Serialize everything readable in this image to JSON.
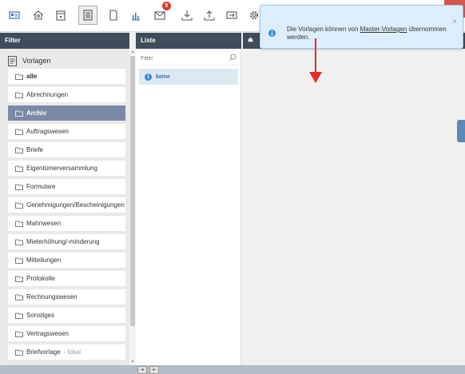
{
  "toolbar": {
    "mail_badge": "9",
    "colors": {
      "accent": "#3a8ad6",
      "badge": "#e0382b"
    }
  },
  "headers": {
    "filter": "Filter",
    "liste": "Liste"
  },
  "filter": {
    "title": "Vorlagen",
    "items": [
      {
        "label": "alle"
      },
      {
        "label": "Abrechnungen"
      },
      {
        "label": "Archiv"
      },
      {
        "label": "Auftragswesen"
      },
      {
        "label": "Briefe"
      },
      {
        "label": "Eigentümerversammlung"
      },
      {
        "label": "Formulare"
      },
      {
        "label": "Genehmigungen/Bescheinigungen"
      },
      {
        "label": "Mahnwesen"
      },
      {
        "label": "Mieterhöhung/-minderung"
      },
      {
        "label": "Mitteilungen"
      },
      {
        "label": "Protokolle"
      },
      {
        "label": "Rechnungswesen"
      },
      {
        "label": "Sonstiges"
      },
      {
        "label": "Vertragswesen"
      },
      {
        "label": "Briefvorlage",
        "suffix": " - lokal"
      }
    ]
  },
  "liste": {
    "filter_placeholder": "Filter",
    "item": "keine"
  },
  "notification": {
    "text_before": "Die Vorlagen können von ",
    "link": "Master-Vorlagen",
    "text_after": " übernommen werden.",
    "close": "×"
  }
}
